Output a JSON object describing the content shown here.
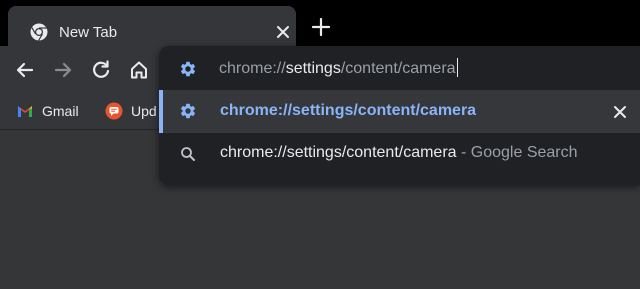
{
  "tab": {
    "title": "New Tab"
  },
  "bookmarks": [
    {
      "label": "Gmail"
    },
    {
      "label": "Upd"
    }
  ],
  "omnibox": {
    "input_prefix": "chrome://",
    "input_bold": "settings",
    "input_suffix": "/content/camera",
    "suggestions": [
      {
        "text": "chrome://settings/content/camera",
        "selected": true
      },
      {
        "text": "chrome://settings/content/camera",
        "suffix": " - Google Search"
      }
    ]
  },
  "colors": {
    "accent": "#8ab4f8",
    "tab_bg": "#35363a",
    "popup_bg": "#202124",
    "text": "#e8eaed",
    "dim_text": "#9aa0a6"
  },
  "icons": [
    "chrome-favicon-icon",
    "close-icon",
    "plus-icon",
    "back-arrow-icon",
    "forward-arrow-icon",
    "reload-icon",
    "home-icon",
    "gmail-icon",
    "updates-icon",
    "settings-gear-icon",
    "search-icon"
  ]
}
